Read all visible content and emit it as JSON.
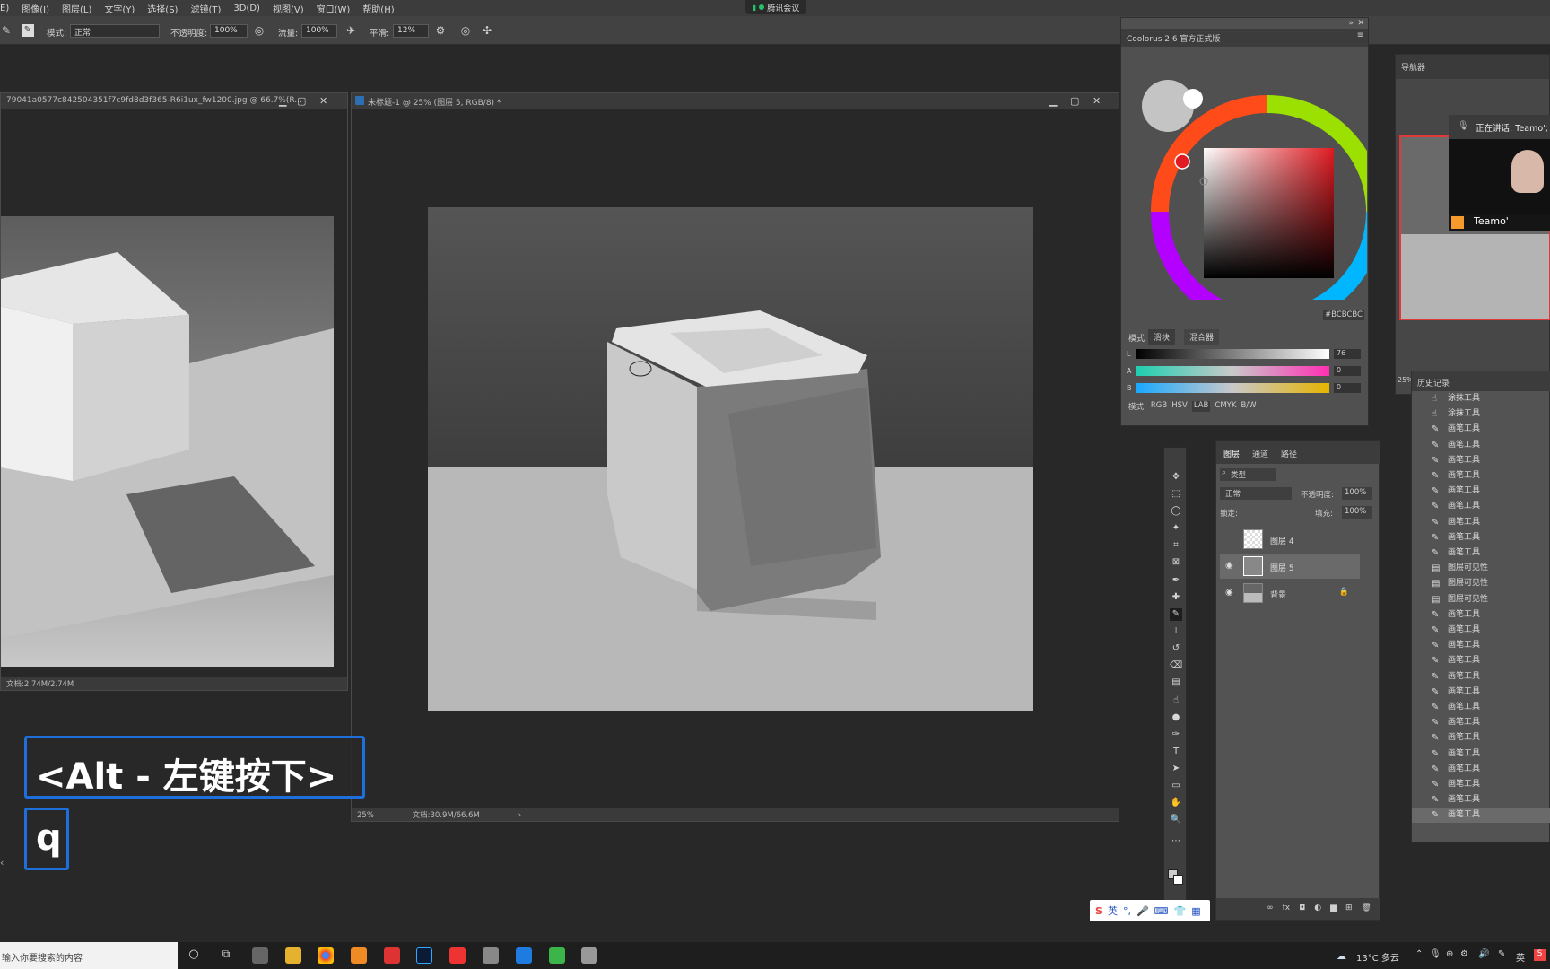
{
  "menubar": {
    "items": [
      "E)",
      "图像(I)",
      "图层(L)",
      "文字(Y)",
      "选择(S)",
      "滤镜(T)",
      "3D(D)",
      "视图(V)",
      "窗口(W)",
      "帮助(H)"
    ],
    "meeting": "腾讯会议"
  },
  "options": {
    "mode_label": "模式:",
    "mode_value": "正常",
    "opacity_label": "不透明度:",
    "opacity_value": "100%",
    "flow_label": "流量:",
    "flow_value": "100%",
    "smooth_label": "平滑:",
    "smooth_value": "12%"
  },
  "doc_left": {
    "title": "79041a0577c842504351f7c9fd8d3f365-R6i1ux_fw1200.jpg @ 66.7%(R...",
    "status": "文档:2.74M/2.74M"
  },
  "doc_main": {
    "title": "未标题-1 @ 25% (图层 5, RGB/8) *",
    "zoom": "25%",
    "status": "文档:30.9M/66.6M"
  },
  "coolorus": {
    "title": "Coolorus 2.6 官方正式版",
    "hex": "#BCBCBC",
    "mode_label": "模式",
    "tab_slider": "滑块",
    "tab_mixer": "混合器",
    "slider_L_label": "L",
    "slider_L_value": "76",
    "slider_A_label": "A",
    "slider_A_value": "0",
    "slider_B_label": "B",
    "slider_B_value": "0",
    "modes_label": "模式:",
    "modes": [
      "RGB",
      "HSV",
      "LAB",
      "CMYK",
      "B/W"
    ]
  },
  "navigator": {
    "title": "导航器",
    "zoom": "25%"
  },
  "meeting": {
    "speaking": "正在讲话: Teamo';",
    "name": "Teamo'"
  },
  "layers": {
    "tabs": [
      "图层",
      "通道",
      "路径"
    ],
    "kind_label": "类型",
    "blend": "正常",
    "opacity_label": "不透明度:",
    "opacity_value": "100%",
    "lock_label": "锁定:",
    "fill_label": "填充:",
    "fill_value": "100%",
    "items": [
      "图层 4",
      "图层 5",
      "背景"
    ]
  },
  "history": {
    "title": "历史记录",
    "items": [
      "涂抹工具",
      "涂抹工具",
      "画笔工具",
      "画笔工具",
      "画笔工具",
      "画笔工具",
      "画笔工具",
      "画笔工具",
      "画笔工具",
      "画笔工具",
      "画笔工具",
      "图层可见性",
      "图层可见性",
      "图层可见性",
      "画笔工具",
      "画笔工具",
      "画笔工具",
      "画笔工具",
      "画笔工具",
      "画笔工具",
      "画笔工具",
      "画笔工具",
      "画笔工具",
      "画笔工具",
      "画笔工具",
      "画笔工具",
      "画笔工具",
      "画笔工具"
    ]
  },
  "keycast": {
    "combo": "<Alt - 左键按下>",
    "key": "q"
  },
  "taskbar": {
    "search_placeholder": "输入你要搜索的内容",
    "weather": "13°C 多云",
    "ime": "英"
  },
  "ime_bar": {
    "label": "英"
  }
}
